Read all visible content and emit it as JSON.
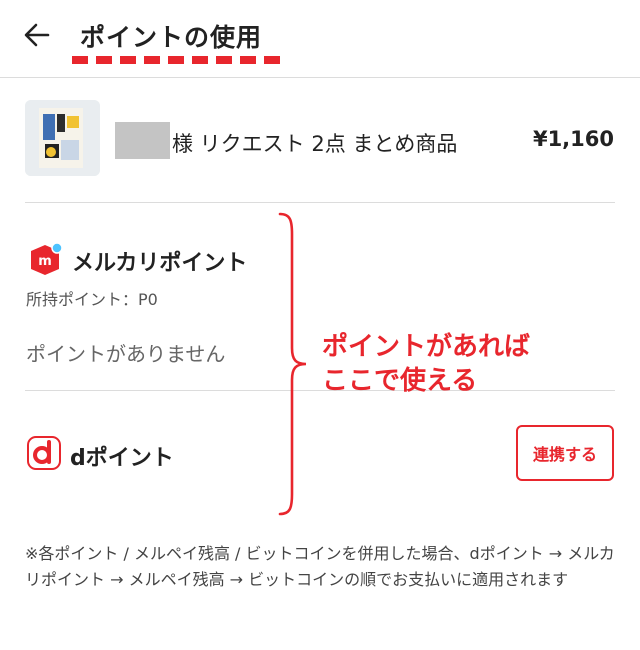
{
  "header": {
    "title": "ポイントの使用",
    "back_icon": "arrow-left-icon"
  },
  "item": {
    "name": "様 リクエスト 2点 まとめ商品",
    "price": "¥1,160",
    "thumbnail_icon": "product-thumbnail"
  },
  "mercari_point": {
    "title": "メルカリポイント",
    "held": "所持ポイント：P0",
    "empty_message": "ポイントがありません",
    "logo_icon": "mercari-logo-icon"
  },
  "d_point": {
    "title": "dポイント",
    "link_label": "連携する",
    "logo_icon": "d-point-logo-icon"
  },
  "annotation": {
    "line1": "ポイントがあれば",
    "line2": "ここで使える"
  },
  "note": "※各ポイント / メルペイ残高 / ビットコインを併用した場合、dポイント → メルカリポイント → メルペイ残高 → ビットコインの順でお支払いに適用されます",
  "colors": {
    "accent": "#e8262d",
    "divider": "#dcdcdc",
    "text": "#222222",
    "muted": "#666666",
    "mercari_dot": "#4dc3ff"
  }
}
